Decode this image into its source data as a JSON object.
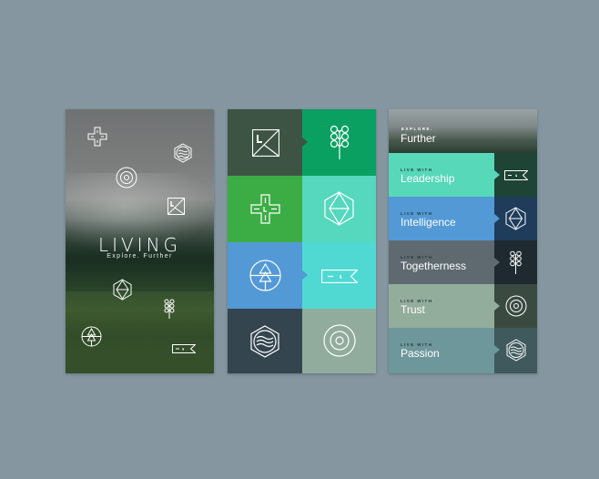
{
  "splash": {
    "title": "LIVING",
    "subtitle": "Explore. Further",
    "icons": [
      "cross-icon",
      "hexagon-waves-icon",
      "target-icon",
      "square-letter-l-icon",
      "octahedron-icon",
      "sprout-icon",
      "tree-circle-icon",
      "flag-banner-icon"
    ]
  },
  "grid": {
    "tiles": [
      {
        "icon": "square-letter-l-icon",
        "color": "#3d5444"
      },
      {
        "icon": "sprout-icon",
        "color": "#0aa062"
      },
      {
        "icon": "cross-icon",
        "color": "#3cad45"
      },
      {
        "icon": "octahedron-icon",
        "color": "#55d8bd"
      },
      {
        "icon": "tree-circle-icon",
        "color": "#5299d6"
      },
      {
        "icon": "flag-banner-icon",
        "color": "#50d9d3"
      },
      {
        "icon": "hexagon-waves-icon",
        "color": "#34454f"
      },
      {
        "icon": "target-icon",
        "color": "#91ac9c"
      }
    ]
  },
  "list": {
    "header": {
      "label": "EXPLORE.",
      "title": "Further"
    },
    "rows": [
      {
        "label": "LIVE WITH",
        "title": "Leadership",
        "icon": "flag-banner-icon",
        "left_color": "#56d8b9",
        "right_color": "#1e4436"
      },
      {
        "label": "LIVE WITH",
        "title": "Intelligence",
        "icon": "octahedron-icon",
        "left_color": "#5299d6",
        "right_color": "#1f3c5b"
      },
      {
        "label": "LIVE WITH",
        "title": "Togetherness",
        "icon": "sprout-icon",
        "left_color": "#5f6a70",
        "right_color": "#1f2a30"
      },
      {
        "label": "LIVE WITH",
        "title": "Trust",
        "icon": "target-icon",
        "left_color": "#93ad9c",
        "right_color": "#3a4a40"
      },
      {
        "label": "LIVE WITH",
        "title": "Passion",
        "icon": "hexagon-waves-icon",
        "left_color": "#6e979b",
        "right_color": "#3f595d"
      }
    ]
  }
}
